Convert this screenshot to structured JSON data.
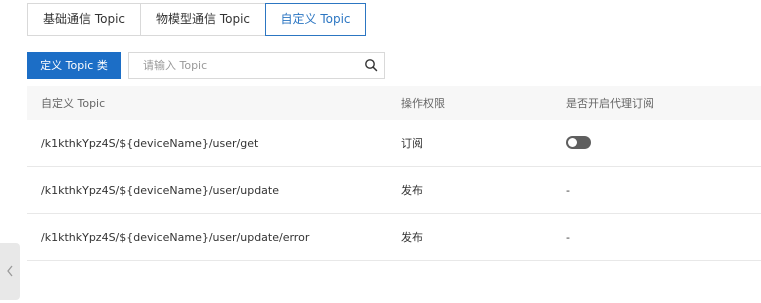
{
  "tabs": [
    {
      "label": "基础通信 Topic",
      "active": false
    },
    {
      "label": "物模型通信 Topic",
      "active": false
    },
    {
      "label": "自定义 Topic",
      "active": true
    }
  ],
  "toolbar": {
    "define_button": "定义 Topic 类",
    "search_placeholder": "请输入 Topic",
    "search_icon": "search-icon"
  },
  "table": {
    "columns": [
      "自定义 Topic",
      "操作权限",
      "是否开启代理订阅"
    ],
    "rows": [
      {
        "topic": "/k1kthkYpz4S/${deviceName}/user/get",
        "permission": "订阅",
        "proxy": {
          "type": "toggle",
          "on": false
        }
      },
      {
        "topic": "/k1kthkYpz4S/${deviceName}/user/update",
        "permission": "发布",
        "proxy": {
          "type": "text",
          "value": "-"
        }
      },
      {
        "topic": "/k1kthkYpz4S/${deviceName}/user/update/error",
        "permission": "发布",
        "proxy": {
          "type": "text",
          "value": "-"
        }
      }
    ]
  },
  "side_handle": {
    "icon": "chevron-left-icon"
  },
  "colors": {
    "accent": "#1c6ec6",
    "active_tab": "#2c76c2",
    "toggle_off": "#5f5f5f",
    "header_bg": "#f7f7f7"
  }
}
